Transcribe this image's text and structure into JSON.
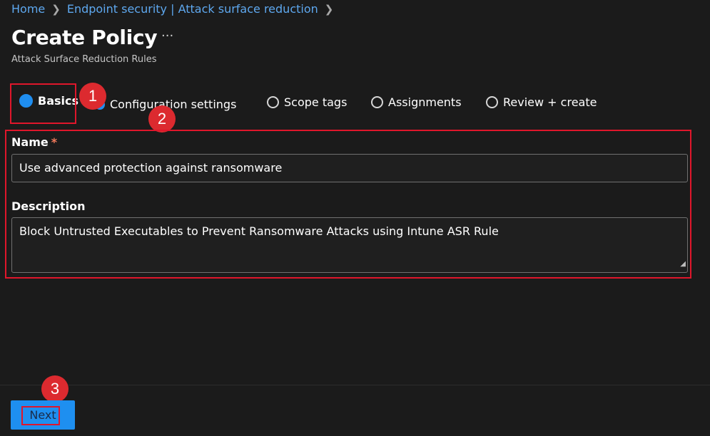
{
  "breadcrumb": {
    "items": [
      "Home",
      "Endpoint security | Attack surface reduction"
    ]
  },
  "header": {
    "title": "Create Policy",
    "more": "···",
    "subtitle": "Attack Surface Reduction Rules"
  },
  "steps": [
    {
      "label": "Basics",
      "state": "active"
    },
    {
      "label": "Configuration settings",
      "state": "pending"
    },
    {
      "label": "Scope tags",
      "state": "pending"
    },
    {
      "label": "Assignments",
      "state": "pending"
    },
    {
      "label": "Review + create",
      "state": "pending"
    }
  ],
  "form": {
    "name_label": "Name",
    "required_marker": "*",
    "name_value": "Use advanced protection against ransomware",
    "description_label": "Description",
    "description_value": "Block Untrusted Executables to Prevent Ransomware Attacks using Intune ASR Rule"
  },
  "annotations": [
    "1",
    "2",
    "3"
  ],
  "footer": {
    "next_label": "Next"
  },
  "colors": {
    "accent": "#1f8ef0",
    "link": "#5ea8ef",
    "highlight": "#e0162b",
    "background": "#1b1b1b"
  }
}
